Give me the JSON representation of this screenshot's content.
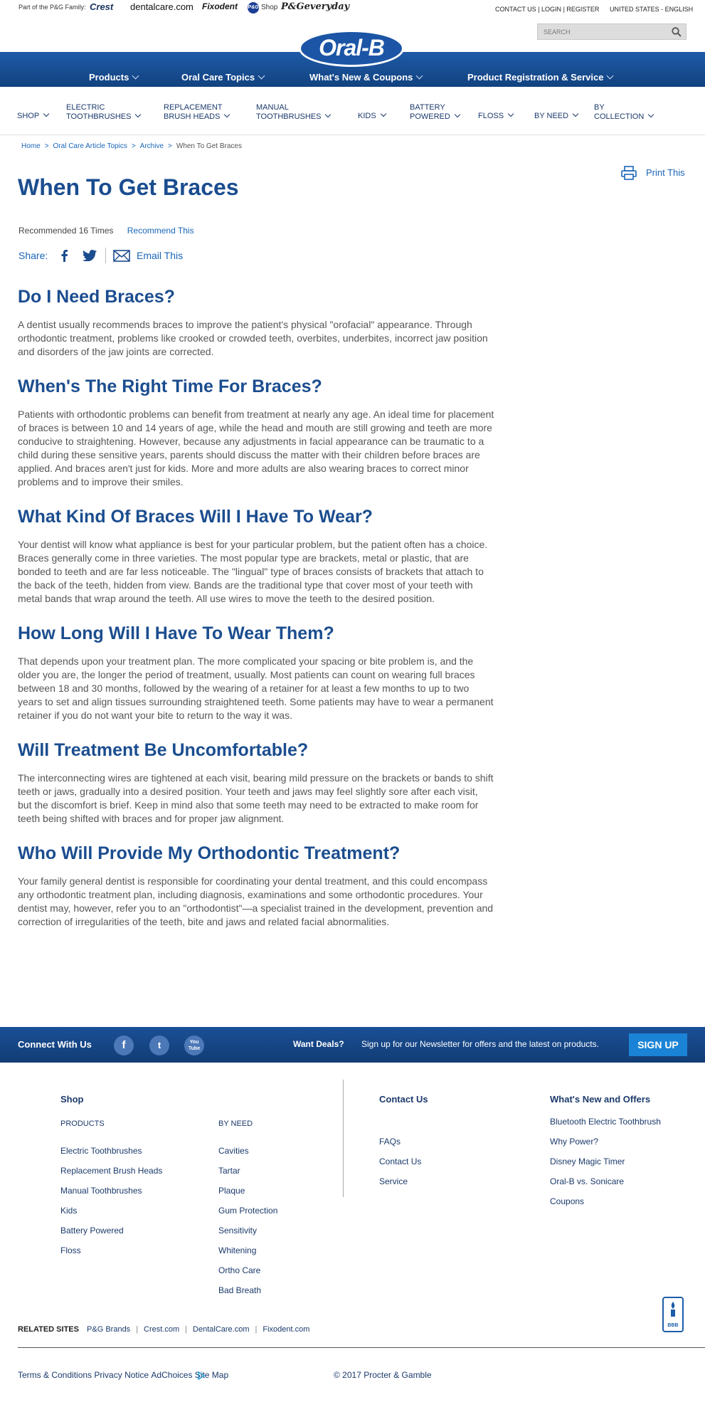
{
  "topbar": {
    "pg_label": "Part of the P&G Family:",
    "brands": {
      "crest": "Crest",
      "dentalcare": "dentalcare.com",
      "fixodent": "Fixodent",
      "pg_circle": "P&G",
      "pg_shop": "Shop",
      "pg_everyday": "P&Geveryday"
    },
    "contact": "CONTACT US",
    "login": "LOGIN",
    "register": "REGISTER",
    "region": "UNITED STATES - ENGLISH",
    "search_placeholder": "SEARCH"
  },
  "logo": "Oral-B",
  "main_nav": [
    "Products",
    "Oral Care Topics",
    "What's New & Coupons",
    "Product Registration & Service"
  ],
  "category_nav": [
    {
      "line1": "SHOP",
      "line2": ""
    },
    {
      "line1": "ELECTRIC",
      "line2": "TOOTHBRUSHES"
    },
    {
      "line1": "REPLACEMENT",
      "line2": "BRUSH HEADS"
    },
    {
      "line1": "MANUAL",
      "line2": "TOOTHBRUSHES"
    },
    {
      "line1": "KIDS",
      "line2": ""
    },
    {
      "line1": "BATTERY",
      "line2": "POWERED"
    },
    {
      "line1": "FLOSS",
      "line2": ""
    },
    {
      "line1": "BY NEED",
      "line2": ""
    },
    {
      "line1": "BY",
      "line2": "COLLECTION"
    }
  ],
  "breadcrumb": [
    "Home",
    "Oral Care Article Topics",
    "Archive",
    "When To Get Braces"
  ],
  "print_label": "Print This",
  "title": "When To Get Braces",
  "recommended": "Recommended 16 Times",
  "recommend_link": "Recommend This",
  "share_label": "Share:",
  "email_label": "Email This",
  "sections": [
    {
      "heading": "Do I Need Braces?",
      "body": "A dentist usually recommends braces to improve the patient's physical \"orofacial\" appearance. Through orthodontic treatment, problems like crooked or crowded teeth, overbites, underbites, incorrect jaw position and disorders of the jaw joints are corrected."
    },
    {
      "heading": "When's The Right Time For Braces?",
      "body": "Patients with orthodontic problems can benefit from treatment at nearly any age. An ideal time for placement of braces is between 10 and 14 years of age, while the head and mouth are still growing and teeth are more conducive to straightening. However, because any adjustments in facial appearance can be traumatic to a child during these sensitive years, parents should discuss the matter with their children before braces are applied. And braces aren't just for kids. More and more adults are also wearing braces to correct minor problems and to improve their smiles."
    },
    {
      "heading": "What Kind Of Braces Will I Have To Wear?",
      "body": "Your dentist will know what appliance is best for your particular problem, but the patient often has a choice. Braces generally come in three varieties. The most popular type are brackets, metal or plastic, that are bonded to teeth and are far less noticeable. The \"lingual\" type of braces consists of brackets that attach to the back of the teeth, hidden from view. Bands are the traditional type that cover most of your teeth with metal bands that wrap around the teeth. All use wires to move the teeth to the desired position."
    },
    {
      "heading": "How Long Will I Have To Wear Them?",
      "body": "That depends upon your treatment plan. The more complicated your spacing or bite problem is, and the older you are, the longer the period of treatment, usually. Most patients can count on wearing full braces between 18 and 30 months, followed by the wearing of a retainer for at least a few months to up to two years to set and align tissues surrounding straightened teeth. Some patients may have to wear a permanent retainer if you do not want your bite to return to the way it was."
    },
    {
      "heading": "Will Treatment Be Uncomfortable?",
      "body": "The interconnecting wires are tightened at each visit, bearing mild pressure on the brackets or bands to shift teeth or jaws, gradually into a desired position. Your teeth and jaws may feel slightly sore after each visit, but the discomfort is brief. Keep in mind also that some teeth may need to be extracted to make room for teeth being shifted with braces and for proper jaw alignment."
    },
    {
      "heading": "Who Will Provide My Orthodontic Treatment?",
      "body": "Your family general dentist is responsible for coordinating your dental treatment, and this could encompass any orthodontic treatment plan, including diagnosis, examinations and some orthodontic procedures. Your dentist may, however, refer you to an \"orthodontist\"—a specialist trained in the development, prevention and correction of irregularities of the teeth, bite and jaws and related facial abnormalities."
    }
  ],
  "connect": {
    "label": "Connect With Us",
    "facebook": "f",
    "twitter": "t",
    "youtube": "You Tube",
    "deals_label": "Want Deals?",
    "deals_text": "Sign up for our Newsletter for offers and the latest on products.",
    "signup": "SIGN UP"
  },
  "footer": {
    "shop_title": "Shop",
    "products_title": "PRODUCTS",
    "products": [
      "Electric Toothbrushes",
      "Replacement Brush Heads",
      "Manual Toothbrushes",
      "Kids",
      "Battery Powered",
      "Floss"
    ],
    "byneed_title": "BY NEED",
    "byneed": [
      "Cavities",
      "Tartar",
      "Plaque",
      "Gum Protection",
      "Sensitivity",
      "Whitening",
      "Ortho Care",
      "Bad Breath"
    ],
    "contact_title": "Contact Us",
    "contact": [
      "FAQs",
      "Contact Us",
      "Service"
    ],
    "whatsnew_title": "What's New and Offers",
    "whatsnew": [
      "Bluetooth Electric Toothbrush",
      "Why Power?",
      "Disney Magic Timer",
      "Oral-B vs. Sonicare",
      "Coupons"
    ]
  },
  "bbb": "BBB",
  "related": {
    "label": "RELATED SITES",
    "links": [
      "P&G Brands",
      "Crest.com",
      "DentalCare.com",
      "Fixodent.com"
    ]
  },
  "legal": [
    "Terms & Conditions",
    "Privacy Notice",
    "AdChoices",
    "Site Map",
    "© 2017 Procter & Gamble"
  ]
}
